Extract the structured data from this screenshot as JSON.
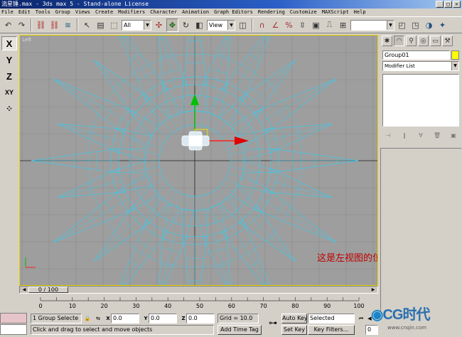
{
  "window": {
    "title": "流星锤.max - 3ds max 5 - Stand-alone License"
  },
  "menu": [
    "File",
    "Edit",
    "Tools",
    "Group",
    "Views",
    "Create",
    "Modifiers",
    "Character",
    "Animation",
    "Graph Editors",
    "Rendering",
    "Customize",
    "MAXScript",
    "Help"
  ],
  "toolbar": {
    "selection_filter": "All",
    "ref_coord": "View",
    "named_selection": ""
  },
  "axis_constraints": [
    "X",
    "Y",
    "Z",
    "XY"
  ],
  "viewport": {
    "label": "Left",
    "annotation": "这是左视图的位置。",
    "wire_color": "#40c8e8",
    "border_color": "#e8d200"
  },
  "command_panel": {
    "object_name": "Group01",
    "object_color": "#ffff00",
    "modifier_list": "Modifier List"
  },
  "time": {
    "slider": "0 / 100",
    "ticks": [
      "0",
      "10",
      "20",
      "30",
      "40",
      "50",
      "60",
      "70",
      "80",
      "90",
      "100"
    ]
  },
  "status": {
    "selection": "1 Group Selecte",
    "x": "0.0",
    "y": "0.0",
    "z": "0.0",
    "grid": "Grid = 10.0",
    "prompt": "Click and drag to select and move objects",
    "add_time_tag": "Add Time Tag",
    "auto_key": "Auto Key",
    "set_key": "Set Key",
    "key_mode": "Selected",
    "key_filters": "Key Filters...",
    "frame": "0"
  },
  "watermark": {
    "logo": "CG时代",
    "url": "www.cnqin.com"
  }
}
